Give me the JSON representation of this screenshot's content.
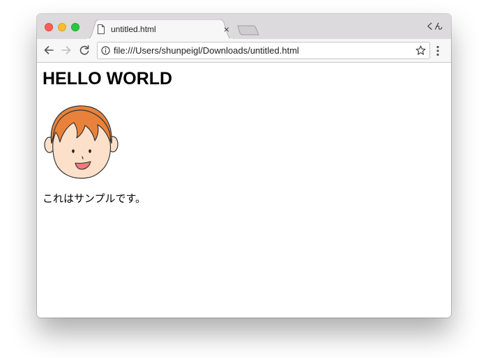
{
  "window": {
    "tab_title": "untitled.html",
    "tab_close_glyph": "×",
    "profile_label": "くん"
  },
  "toolbar": {
    "url": "file:///Users/shunpeigl/Downloads/untitled.html",
    "icons": {
      "back": "back-arrow-icon",
      "forward": "forward-arrow-icon",
      "reload": "reload-icon",
      "info": "info-icon",
      "bookmark": "star-icon",
      "menu": "kebab-menu-icon"
    }
  },
  "page": {
    "heading": "HELLO WORLD",
    "image_label": "cartoon-face-illustration",
    "paragraph": "これはサンプルです。"
  },
  "colors": {
    "titlebar": "#dcdadc",
    "hair": "#e8823a",
    "skin": "#fde0c9",
    "mouth": "#f07a7a",
    "close": "#fc5f57",
    "minimize": "#fdbc2e",
    "maximize": "#28c840"
  }
}
